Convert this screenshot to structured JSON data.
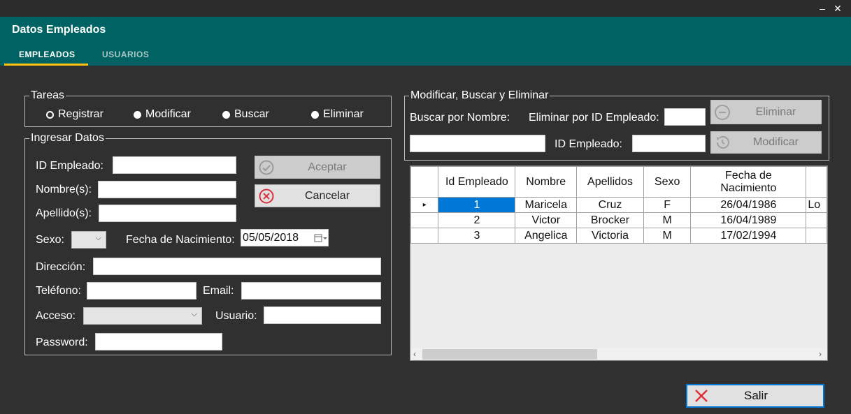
{
  "window": {
    "minimize_glyph": "–",
    "close_glyph": "✕",
    "title": "Datos Empleados"
  },
  "tabs": [
    {
      "label": "EMPLEADOS",
      "active": true
    },
    {
      "label": "USUARIOS",
      "active": false
    }
  ],
  "colors": {
    "header": "#006262",
    "tab_indicator": "#ffc20e",
    "background": "#303030",
    "selection": "#0078d7"
  },
  "tareas": {
    "legend": "Tareas",
    "options": [
      {
        "label": "Registrar",
        "selected": true
      },
      {
        "label": "Modificar",
        "selected": false
      },
      {
        "label": "Buscar",
        "selected": false
      },
      {
        "label": "Eliminar",
        "selected": false
      }
    ]
  },
  "ingresar": {
    "legend": "Ingresar Datos",
    "id_label": "ID Empleado:",
    "nombre_label": "Nombre(s):",
    "apellido_label": "Apellido(s):",
    "sexo_label": "Sexo:",
    "fecha_label": "Fecha de Nacimiento:",
    "fecha_value": "05/05/2018",
    "direccion_label": "Dirección:",
    "telefono_label": "Teléfono:",
    "email_label": "Email:",
    "acceso_label": "Acceso:",
    "usuario_label": "Usuario:",
    "password_label": "Password:",
    "aceptar_label": "Aceptar",
    "cancelar_label": "Cancelar"
  },
  "modificar": {
    "legend": "Modificar, Buscar y Eliminar",
    "buscar_label": "Buscar por Nombre:",
    "eliminar_id_label": "Eliminar por ID Empleado:",
    "id_label": "ID Empleado:",
    "eliminar_label": "Eliminar",
    "modificar_label": "Modificar"
  },
  "grid": {
    "columns": [
      "Id Empleado",
      "Nombre",
      "Apellidos",
      "Sexo",
      "Fecha de Nacimiento",
      ""
    ],
    "rows": [
      [
        "1",
        "Maricela",
        "Cruz",
        "F",
        "26/04/1986",
        "Lo"
      ],
      [
        "2",
        "Victor",
        "Brocker",
        "M",
        "16/04/1989",
        ""
      ],
      [
        "3",
        "Angelica",
        "Victoria",
        "M",
        "17/02/1994",
        ""
      ]
    ],
    "row_indicator": "▸"
  },
  "salir_label": "Salir"
}
